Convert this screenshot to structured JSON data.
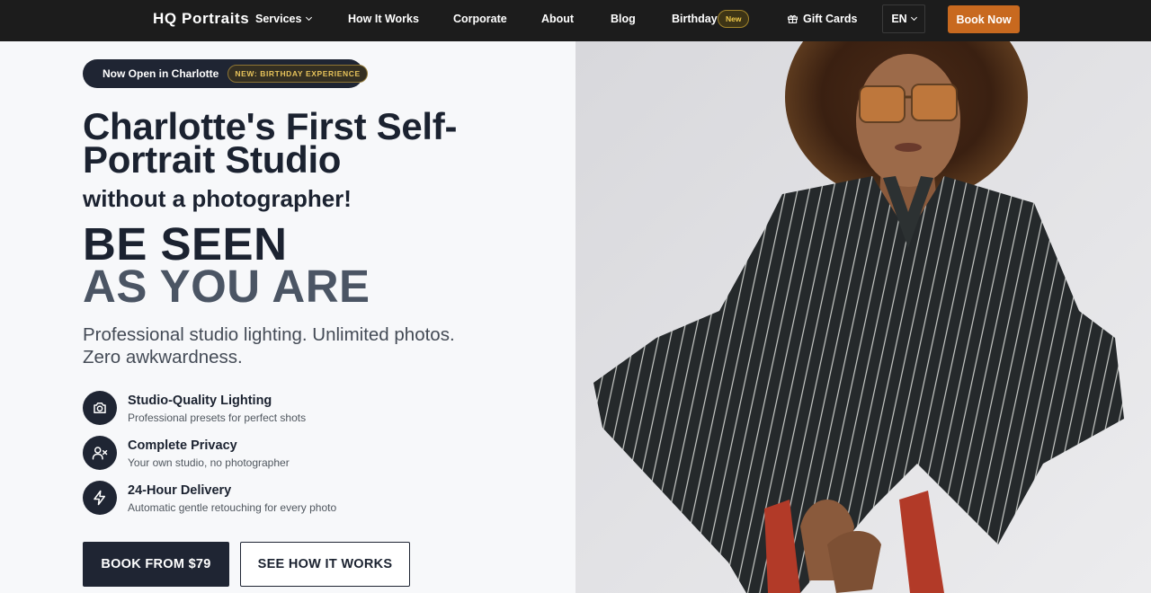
{
  "nav": {
    "brand": "HQ Portraits",
    "items": [
      {
        "label": "Services"
      },
      {
        "label": "How It Works"
      },
      {
        "label": "Corporate"
      },
      {
        "label": "About"
      },
      {
        "label": "Blog"
      },
      {
        "label": "Birthday"
      },
      {
        "label": "Gift Cards"
      }
    ],
    "birthday_badge": "New",
    "language": "EN",
    "book_now": "Book Now"
  },
  "announcement": {
    "text": "Now Open in Charlotte",
    "badge": "NEW: BIRTHDAY EXPERIENCE"
  },
  "hero": {
    "title": "Charlotte's First Self-Portrait Studio",
    "subtitle": "without a photographer!",
    "slogan_line1": "BE SEEN",
    "slogan_line2": "AS YOU ARE",
    "description": "Professional studio lighting. Unlimited photos. Zero awkwardness."
  },
  "features": [
    {
      "icon": "camera-icon",
      "title": "Studio-Quality Lighting",
      "text": "Professional presets for perfect shots"
    },
    {
      "icon": "user-x-icon",
      "title": "Complete Privacy",
      "text": "Your own studio, no photographer"
    },
    {
      "icon": "lightning-icon",
      "title": "24-Hour Delivery",
      "text": "Automatic gentle retouching for every photo"
    }
  ],
  "cta": {
    "primary": "BOOK FROM $79",
    "secondary": "SEE HOW IT WORKS"
  },
  "colors": {
    "nav_bg": "#1c1c1c",
    "accent": "#c8691f",
    "dark": "#1f2533",
    "badge_gold": "#e6c25a"
  }
}
